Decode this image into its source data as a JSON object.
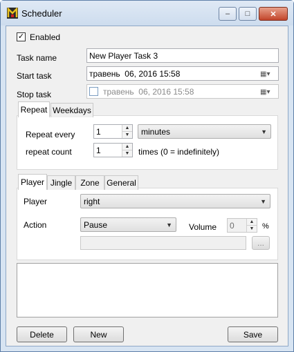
{
  "window": {
    "title": "Scheduler",
    "controls": {
      "minimize": "‒",
      "maximize": "□",
      "close": "✕"
    }
  },
  "enabled": {
    "label": "Enabled",
    "checked": true
  },
  "task_name": {
    "label": "Task name",
    "value": "New Player Task 3"
  },
  "start_task": {
    "label": "Start task",
    "value": "травень  06, 2016 15:58"
  },
  "stop_task": {
    "label": "Stop task",
    "value": "травень  06, 2016 15:58",
    "checked": false
  },
  "repeat_tabs": [
    "Repeat",
    "Weekdays"
  ],
  "repeat": {
    "every_label": "Repeat every",
    "every_value": "1",
    "unit": "minutes",
    "count_label": "repeat count",
    "count_value": "1",
    "count_hint": "times (0 = indefinitely)"
  },
  "action_tabs": [
    "Player",
    "Jingle",
    "Zone",
    "General"
  ],
  "player": {
    "player_label": "Player",
    "player_value": "right",
    "action_label": "Action",
    "action_value": "Pause",
    "volume_label": "Volume",
    "volume_value": "0",
    "volume_unit": "%",
    "browse_label": "..."
  },
  "buttons": {
    "delete": "Delete",
    "new": "New",
    "save": "Save"
  },
  "colors": {
    "title_bar": "#cddcee",
    "close_button": "#c2452b",
    "client_bg": "#f0f0f0"
  }
}
